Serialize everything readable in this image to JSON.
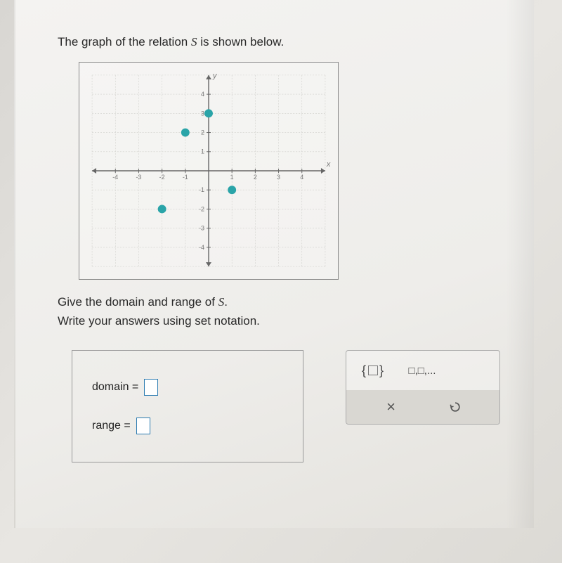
{
  "prompt_pre": "The graph of the relation ",
  "prompt_relation": "S",
  "prompt_post": " is shown below.",
  "instruction_line1_pre": "Give the domain and range of ",
  "instruction_line1_rel": "S",
  "instruction_line1_post": ".",
  "instruction_line2": "Write your answers using set notation.",
  "domain_label": "domain =",
  "range_label": "range =",
  "tool_setlist": "□,□,...",
  "tool_close": "×",
  "chart_data": {
    "type": "scatter",
    "title": "",
    "xlabel": "x",
    "ylabel": "y",
    "xlim": [
      -5,
      5
    ],
    "ylim": [
      -5,
      5
    ],
    "x_ticks": [
      -4,
      -3,
      -2,
      -1,
      1,
      2,
      3,
      4
    ],
    "y_ticks": [
      -4,
      -3,
      -2,
      -1,
      1,
      2,
      3,
      4
    ],
    "grid": true,
    "points": [
      {
        "x": 0,
        "y": 3
      },
      {
        "x": -1,
        "y": 2
      },
      {
        "x": 1,
        "y": -1
      },
      {
        "x": -2,
        "y": -2
      }
    ],
    "point_color": "#2aa4a8",
    "axis_color": "#666666",
    "grid_color": "#cfcfcb",
    "tick_label_color": "#777777"
  }
}
